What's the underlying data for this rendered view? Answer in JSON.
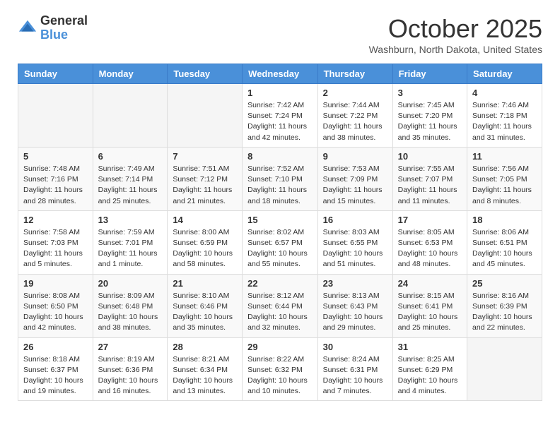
{
  "logo": {
    "general": "General",
    "blue": "Blue"
  },
  "title": "October 2025",
  "location": "Washburn, North Dakota, United States",
  "headers": [
    "Sunday",
    "Monday",
    "Tuesday",
    "Wednesday",
    "Thursday",
    "Friday",
    "Saturday"
  ],
  "weeks": [
    [
      {
        "day": "",
        "info": ""
      },
      {
        "day": "",
        "info": ""
      },
      {
        "day": "",
        "info": ""
      },
      {
        "day": "1",
        "info": "Sunrise: 7:42 AM\nSunset: 7:24 PM\nDaylight: 11 hours\nand 42 minutes."
      },
      {
        "day": "2",
        "info": "Sunrise: 7:44 AM\nSunset: 7:22 PM\nDaylight: 11 hours\nand 38 minutes."
      },
      {
        "day": "3",
        "info": "Sunrise: 7:45 AM\nSunset: 7:20 PM\nDaylight: 11 hours\nand 35 minutes."
      },
      {
        "day": "4",
        "info": "Sunrise: 7:46 AM\nSunset: 7:18 PM\nDaylight: 11 hours\nand 31 minutes."
      }
    ],
    [
      {
        "day": "5",
        "info": "Sunrise: 7:48 AM\nSunset: 7:16 PM\nDaylight: 11 hours\nand 28 minutes."
      },
      {
        "day": "6",
        "info": "Sunrise: 7:49 AM\nSunset: 7:14 PM\nDaylight: 11 hours\nand 25 minutes."
      },
      {
        "day": "7",
        "info": "Sunrise: 7:51 AM\nSunset: 7:12 PM\nDaylight: 11 hours\nand 21 minutes."
      },
      {
        "day": "8",
        "info": "Sunrise: 7:52 AM\nSunset: 7:10 PM\nDaylight: 11 hours\nand 18 minutes."
      },
      {
        "day": "9",
        "info": "Sunrise: 7:53 AM\nSunset: 7:09 PM\nDaylight: 11 hours\nand 15 minutes."
      },
      {
        "day": "10",
        "info": "Sunrise: 7:55 AM\nSunset: 7:07 PM\nDaylight: 11 hours\nand 11 minutes."
      },
      {
        "day": "11",
        "info": "Sunrise: 7:56 AM\nSunset: 7:05 PM\nDaylight: 11 hours\nand 8 minutes."
      }
    ],
    [
      {
        "day": "12",
        "info": "Sunrise: 7:58 AM\nSunset: 7:03 PM\nDaylight: 11 hours\nand 5 minutes."
      },
      {
        "day": "13",
        "info": "Sunrise: 7:59 AM\nSunset: 7:01 PM\nDaylight: 11 hours\nand 1 minute."
      },
      {
        "day": "14",
        "info": "Sunrise: 8:00 AM\nSunset: 6:59 PM\nDaylight: 10 hours\nand 58 minutes."
      },
      {
        "day": "15",
        "info": "Sunrise: 8:02 AM\nSunset: 6:57 PM\nDaylight: 10 hours\nand 55 minutes."
      },
      {
        "day": "16",
        "info": "Sunrise: 8:03 AM\nSunset: 6:55 PM\nDaylight: 10 hours\nand 51 minutes."
      },
      {
        "day": "17",
        "info": "Sunrise: 8:05 AM\nSunset: 6:53 PM\nDaylight: 10 hours\nand 48 minutes."
      },
      {
        "day": "18",
        "info": "Sunrise: 8:06 AM\nSunset: 6:51 PM\nDaylight: 10 hours\nand 45 minutes."
      }
    ],
    [
      {
        "day": "19",
        "info": "Sunrise: 8:08 AM\nSunset: 6:50 PM\nDaylight: 10 hours\nand 42 minutes."
      },
      {
        "day": "20",
        "info": "Sunrise: 8:09 AM\nSunset: 6:48 PM\nDaylight: 10 hours\nand 38 minutes."
      },
      {
        "day": "21",
        "info": "Sunrise: 8:10 AM\nSunset: 6:46 PM\nDaylight: 10 hours\nand 35 minutes."
      },
      {
        "day": "22",
        "info": "Sunrise: 8:12 AM\nSunset: 6:44 PM\nDaylight: 10 hours\nand 32 minutes."
      },
      {
        "day": "23",
        "info": "Sunrise: 8:13 AM\nSunset: 6:43 PM\nDaylight: 10 hours\nand 29 minutes."
      },
      {
        "day": "24",
        "info": "Sunrise: 8:15 AM\nSunset: 6:41 PM\nDaylight: 10 hours\nand 25 minutes."
      },
      {
        "day": "25",
        "info": "Sunrise: 8:16 AM\nSunset: 6:39 PM\nDaylight: 10 hours\nand 22 minutes."
      }
    ],
    [
      {
        "day": "26",
        "info": "Sunrise: 8:18 AM\nSunset: 6:37 PM\nDaylight: 10 hours\nand 19 minutes."
      },
      {
        "day": "27",
        "info": "Sunrise: 8:19 AM\nSunset: 6:36 PM\nDaylight: 10 hours\nand 16 minutes."
      },
      {
        "day": "28",
        "info": "Sunrise: 8:21 AM\nSunset: 6:34 PM\nDaylight: 10 hours\nand 13 minutes."
      },
      {
        "day": "29",
        "info": "Sunrise: 8:22 AM\nSunset: 6:32 PM\nDaylight: 10 hours\nand 10 minutes."
      },
      {
        "day": "30",
        "info": "Sunrise: 8:24 AM\nSunset: 6:31 PM\nDaylight: 10 hours\nand 7 minutes."
      },
      {
        "day": "31",
        "info": "Sunrise: 8:25 AM\nSunset: 6:29 PM\nDaylight: 10 hours\nand 4 minutes."
      },
      {
        "day": "",
        "info": ""
      }
    ]
  ]
}
